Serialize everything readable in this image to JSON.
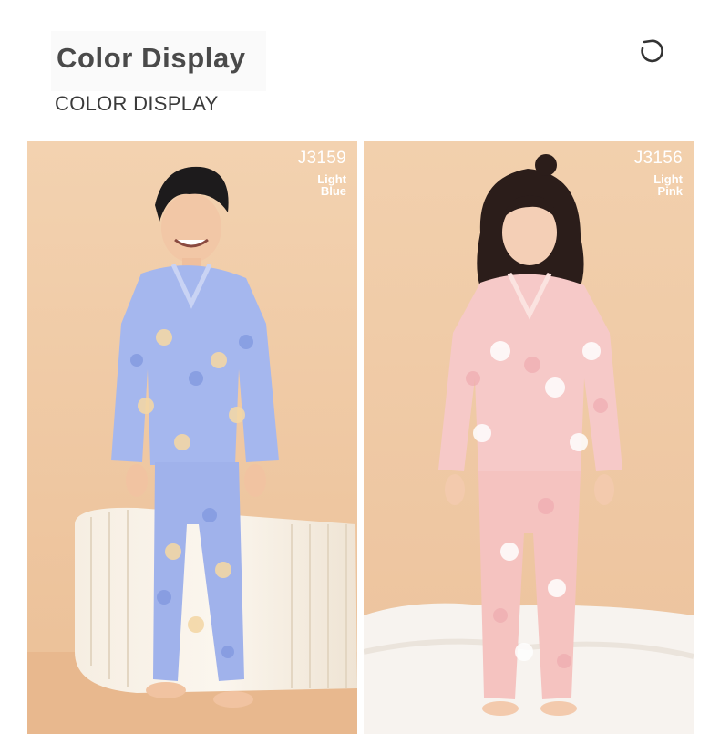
{
  "header": {
    "title": "Color Display",
    "subtitle": "COLOR DISPLAY",
    "icon": "rotate-icon"
  },
  "products": [
    {
      "code": "J3159",
      "color_line1": "Light",
      "color_line2": "Blue",
      "image": "boy-in-light-blue-bear-print-pajamas",
      "pajama_color": "#a5b7ee"
    },
    {
      "code": "J3156",
      "color_line1": "Light",
      "color_line2": "Pink",
      "image": "girl-in-light-pink-bear-print-pajamas",
      "pajama_color": "#f6c9c8"
    }
  ],
  "colors": {
    "title": "#4a4a4a",
    "subtitle": "#3a3a3a",
    "backdrop": "#f2d0ad",
    "label": "#ffffff"
  }
}
